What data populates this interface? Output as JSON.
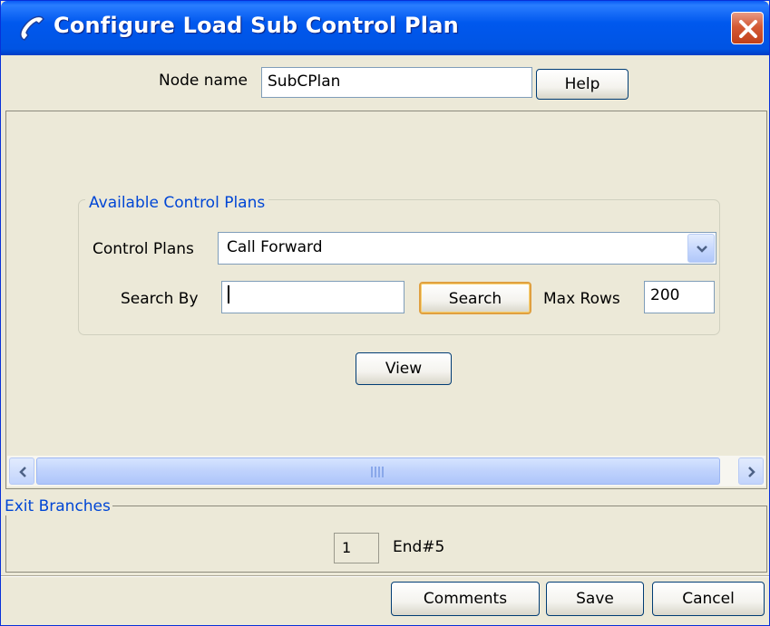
{
  "window": {
    "title": "Configure Load Sub Control Plan",
    "title_icon": "phone-handset-icon",
    "close_icon": "close-icon",
    "titlebar_color": "#0054e3",
    "close_color": "#d45a35"
  },
  "node": {
    "label": "Node name",
    "value": "SubCPlan",
    "help_label": "Help"
  },
  "available_control_plans": {
    "legend": "Available Control Plans",
    "control_plans_label": "Control Plans",
    "control_plans_selected": "Call Forward",
    "search_by_label": "Search By",
    "search_by_value": "",
    "search_button": "Search",
    "max_rows_label": "Max Rows",
    "max_rows_value": "200",
    "view_button": "View"
  },
  "scrollbar": {
    "left_icon": "scroll-left-icon",
    "right_icon": "scroll-right-icon"
  },
  "exit_branches": {
    "legend": "Exit Branches",
    "items": [
      {
        "number": "1",
        "name": "End#5"
      }
    ]
  },
  "footer": {
    "comments": "Comments",
    "save": "Save",
    "cancel": "Cancel"
  },
  "colors": {
    "accent_text": "#0046d5",
    "background": "#ece9d8"
  }
}
